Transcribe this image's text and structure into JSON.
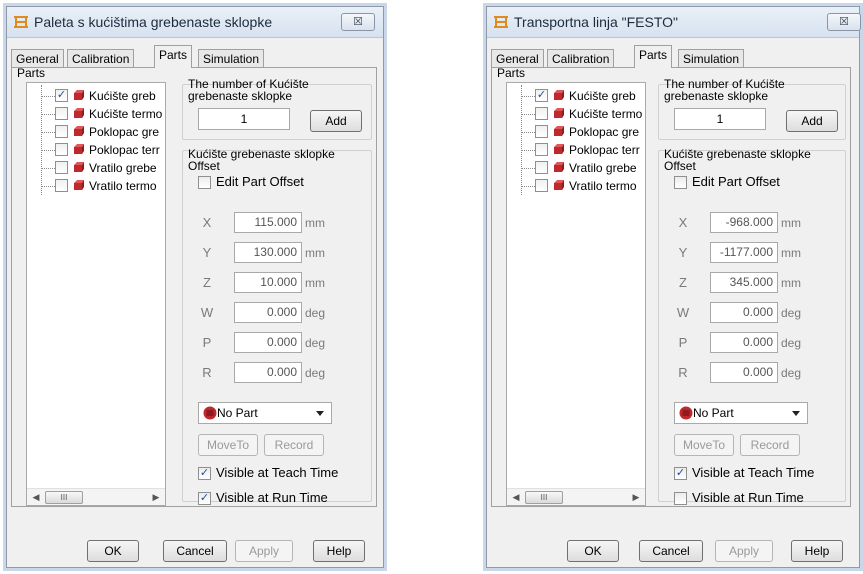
{
  "tabs": [
    "General",
    "Calibration",
    "Parts",
    "Simulation"
  ],
  "parts_group_label": "Parts",
  "count_group_label": "The number of Kućište grebenaste sklopke",
  "offset_group_label": "Kućište grebenaste sklopke Offset",
  "edit_offset_label": "Edit Part Offset",
  "add_label": "Add",
  "no_part_label": "No Part",
  "moveto_label": "MoveTo",
  "record_label": "Record",
  "visible_teach_label": "Visible at Teach Time",
  "visible_run_label": "Visible at Run Time",
  "ok_label": "OK",
  "cancel_label": "Cancel",
  "apply_label": "Apply",
  "help_label": "Help",
  "close_glyph": "☒",
  "axes": [
    "X",
    "Y",
    "Z",
    "W",
    "P",
    "R"
  ],
  "units": [
    "mm",
    "mm",
    "mm",
    "deg",
    "deg",
    "deg"
  ],
  "scroll_thumb": "III",
  "colors": {
    "part_icon": "#c0282d",
    "check_mark": "#1e4e9a",
    "title_icon": "#e08a1f"
  },
  "dialogs": [
    {
      "title": "Paleta s kućištima grebenaste sklopke",
      "tree_items": [
        {
          "label": "Kućište greb",
          "checked": true
        },
        {
          "label": "Kućište termo",
          "checked": false
        },
        {
          "label": "Poklopac gre",
          "checked": false
        },
        {
          "label": "Poklopac terr",
          "checked": false
        },
        {
          "label": "Vratilo grebe",
          "checked": false
        },
        {
          "label": "Vratilo termo",
          "checked": false
        }
      ],
      "count": "1",
      "offsets": [
        "115.000",
        "130.000",
        "10.000",
        "0.000",
        "0.000",
        "0.000"
      ],
      "visible_teach": true,
      "visible_run": true
    },
    {
      "title": "Transportna linja \"FESTO\"",
      "tree_items": [
        {
          "label": "Kućište greb",
          "checked": true
        },
        {
          "label": "Kućište termo",
          "checked": false
        },
        {
          "label": "Poklopac gre",
          "checked": false
        },
        {
          "label": "Poklopac terr",
          "checked": false
        },
        {
          "label": "Vratilo grebe",
          "checked": false
        },
        {
          "label": "Vratilo termo",
          "checked": false
        }
      ],
      "count": "1",
      "offsets": [
        "-968.000",
        "-1177.000",
        "345.000",
        "0.000",
        "0.000",
        "0.000"
      ],
      "visible_teach": true,
      "visible_run": false
    }
  ]
}
